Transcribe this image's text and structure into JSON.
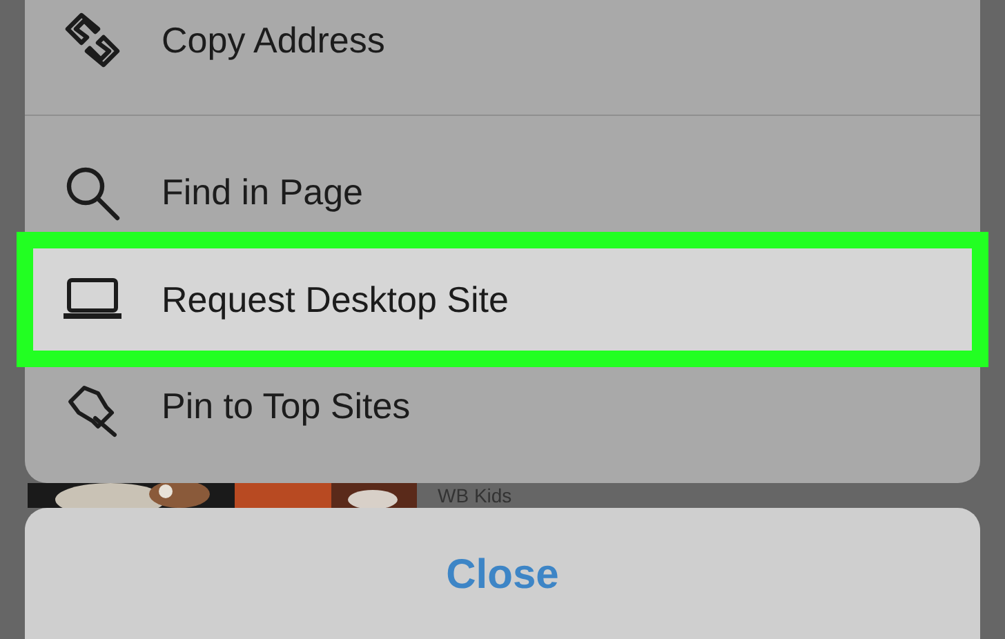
{
  "menu": {
    "groups": [
      [
        {
          "kind": "link",
          "label": "Copy Address",
          "selected": false
        }
      ],
      [
        {
          "kind": "search",
          "label": "Find in Page",
          "selected": false
        },
        {
          "kind": "laptop",
          "label": "Request Desktop Site",
          "selected": true
        },
        {
          "kind": "pin",
          "label": "Pin to Top Sites",
          "selected": false
        }
      ]
    ]
  },
  "background": {
    "channel": "WB Kids"
  },
  "close_button": "Close"
}
